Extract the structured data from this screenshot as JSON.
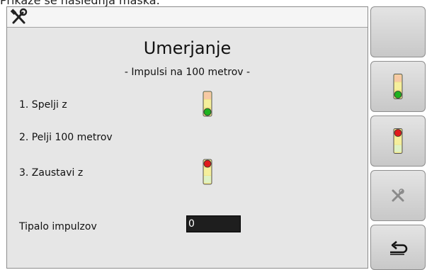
{
  "caption": "Prikaže se naslednja maska:",
  "header": {
    "icon": "tools-icon"
  },
  "main": {
    "title": "Umerjanje",
    "subtitle": "- Impulsi na 100 metrov -",
    "steps": [
      {
        "label": "1. Spelji z",
        "light": "green"
      },
      {
        "label": "2. Pelji 100 metrov",
        "light": "none"
      },
      {
        "label": "3. Zaustavi z",
        "light": "red"
      }
    ],
    "impulse_label": "Tipalo impulzov",
    "impulse_value": "0"
  },
  "sidebar": {
    "buttons": [
      {
        "name": "empty-button",
        "icon": "none"
      },
      {
        "name": "start-button",
        "icon": "green-traffic-light-icon"
      },
      {
        "name": "stop-button",
        "icon": "red-traffic-light-icon"
      },
      {
        "name": "cancel-button",
        "icon": "cancel-icon"
      },
      {
        "name": "back-button",
        "icon": "return-arrow-icon"
      }
    ]
  },
  "colors": {
    "light_green": "#1fb21f",
    "light_red": "#e01b1b",
    "light_body": "#f2e68a",
    "field_bg": "#1e1e1e"
  }
}
